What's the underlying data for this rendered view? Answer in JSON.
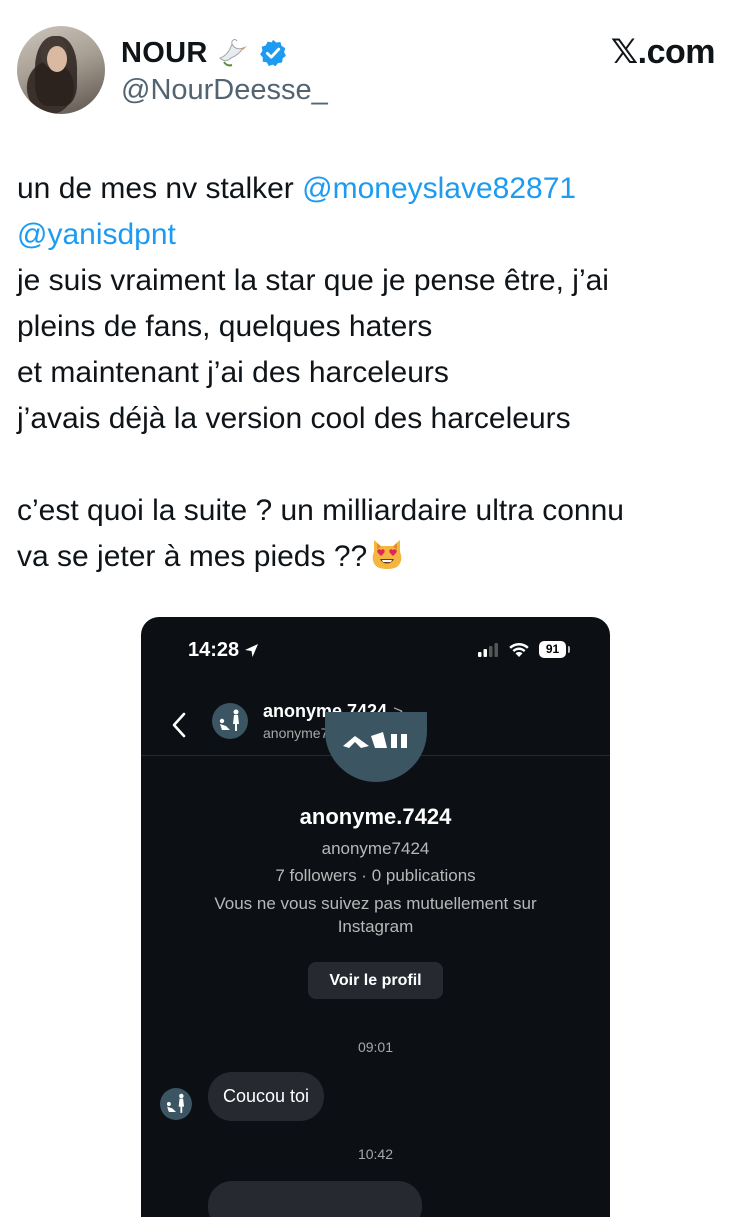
{
  "tweet": {
    "author_name": "NOUR",
    "author_handle": "@NourDeesse_",
    "brand": "𝕏.com",
    "lines": [
      {
        "text": "un de mes nv stalker ",
        "mention": "@moneyslave82871"
      },
      {
        "mention": "@yanisdpnt"
      },
      {
        "text": "je suis vraiment la star que je pense être, j’ai"
      },
      {
        "text": "pleins de fans, quelques haters"
      },
      {
        "text": "et maintenant j’ai des harceleurs"
      },
      {
        "text": "j’avais déjà la version cool des harceleurs"
      },
      {
        "text": "c’est quoi la suite ? un milliardaire ultra connu"
      },
      {
        "text": "va se jeter à mes pieds ??"
      }
    ],
    "emoji": "heart-eyes-cat",
    "accent_color": "#1d9bf0"
  },
  "screenshot": {
    "status_time": "14:28",
    "battery": "91",
    "nav_title": "anonyme.7424",
    "nav_chevron": ">",
    "nav_subtitle": "anonyme7424",
    "profile_name": "anonyme.7424",
    "profile_username": "anonyme7424",
    "profile_stats": "7 followers · 0 publications",
    "profile_mutual": "Vous ne vous suivez pas mutuellement sur Instagram",
    "view_profile_label": "Voir le profil",
    "timestamp_1": "09:01",
    "message_1": "Coucou toi",
    "timestamp_2": "10:42"
  }
}
